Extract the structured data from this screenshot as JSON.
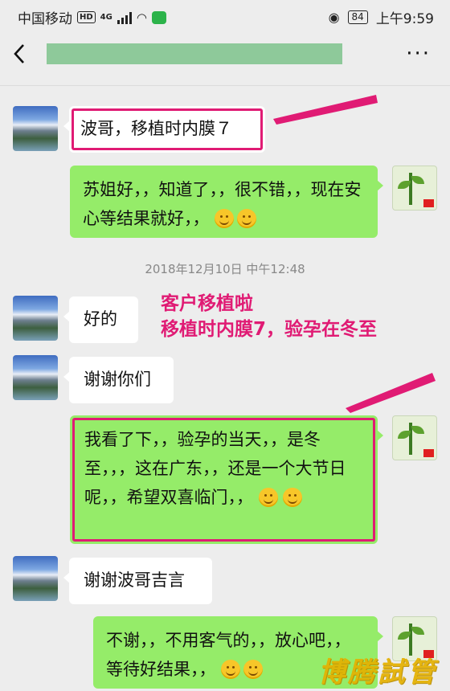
{
  "status_bar": {
    "carrier": "中国移动",
    "hd": "HD",
    "network": "4G",
    "battery": "84",
    "time": "上午9:59"
  },
  "title_bar": {
    "back_icon": "chevron-left-icon",
    "more_label": "···"
  },
  "messages": [
    {
      "side": "left",
      "text": "波哥，移植时内膜７",
      "highlighted": true
    },
    {
      "side": "right",
      "text": "苏姐好，，知道了，，很不错，，现在安心等结果就好，，",
      "emoji_count": 2
    },
    {
      "side": "timestamp",
      "text": "2018年12月10日 中午12:48"
    },
    {
      "side": "left",
      "text": "好的"
    },
    {
      "side": "left",
      "text": "谢谢你们"
    },
    {
      "side": "right",
      "text_a": "我看了下，，验孕的当天，，是冬至，，，这在广东，，还是一个大节日呢，，希望双喜临门，，",
      "highlighted": true,
      "emoji_count": 2
    },
    {
      "side": "left",
      "text": "谢谢波哥吉言"
    },
    {
      "side": "right",
      "text": "不谢，，不用客气的，，放心吧，，等待好结果，，",
      "emoji_count": 2
    }
  ],
  "annotation": {
    "line1": "客户移植啦",
    "line2": "移植时内膜7，验孕在冬至",
    "color": "#e01b74"
  },
  "watermark": "博腾試管",
  "colors": {
    "accent": "#e01b74",
    "green_bubble": "#95ec69",
    "background": "#ededed"
  }
}
